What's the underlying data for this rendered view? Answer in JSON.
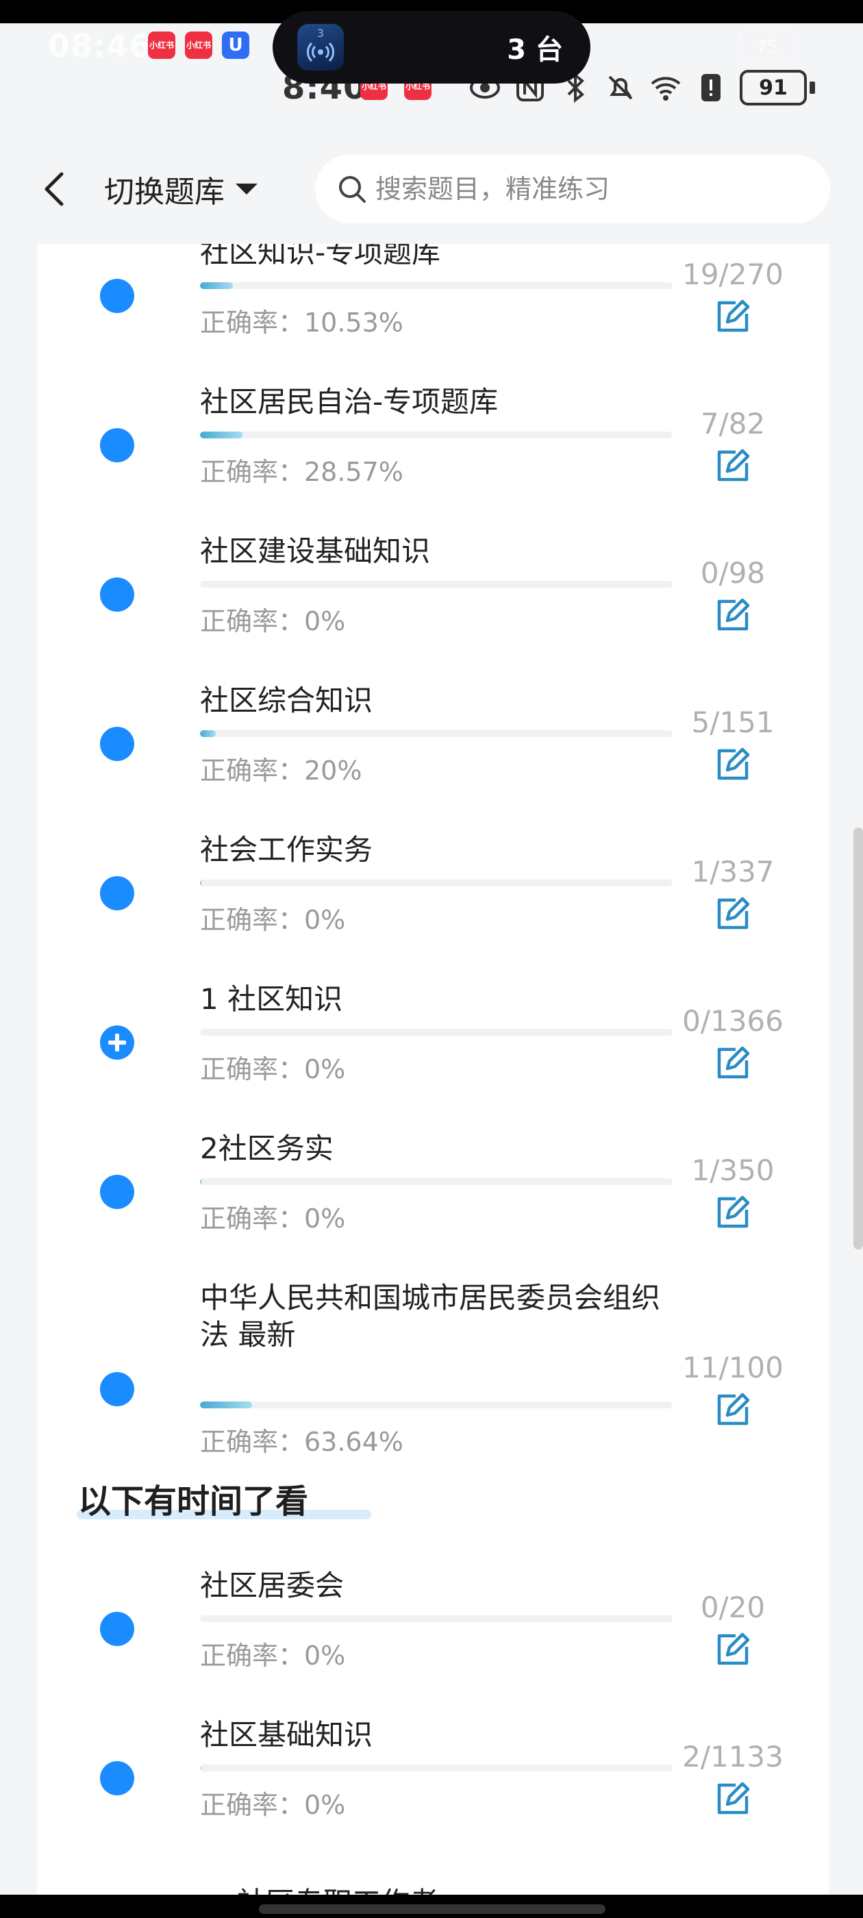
{
  "status_bar": {
    "time": "8:40",
    "time_overlay": "08:46",
    "battery": "91",
    "battery_overlay": "75",
    "app_badges": [
      {
        "label": "小红书",
        "color": "#ef2f42"
      },
      {
        "label": "小红书",
        "color": "#ef2f42"
      },
      {
        "label": "U",
        "color": "#2f6df6"
      }
    ],
    "time_badges": [
      {
        "label": "小红书",
        "color": "#ef2f42"
      },
      {
        "label": "小红书",
        "color": "#ef2f42"
      }
    ]
  },
  "island": {
    "icon_badge": "3",
    "text": "3 台"
  },
  "header": {
    "back_icon": "chevron-left-icon",
    "bank_switch_label": "切换题库",
    "search_placeholder": "搜索题目，精准练习"
  },
  "items_group1": [
    {
      "name": "社区知识-专项题库",
      "rate": "正确率：10.53%",
      "count": "19/270",
      "progress": 0.07,
      "marker": "dot"
    },
    {
      "name": "社区居民自治-专项题库",
      "rate": "正确率：28.57%",
      "count": "7/82",
      "progress": 0.09,
      "marker": "dot"
    },
    {
      "name": "社区建设基础知识",
      "rate": "正确率：0%",
      "count": "0/98",
      "progress": 0.0,
      "marker": "dot"
    },
    {
      "name": "社区综合知识",
      "rate": "正确率：20%",
      "count": "5/151",
      "progress": 0.033,
      "marker": "dot"
    },
    {
      "name": "社会工作实务",
      "rate": "正确率：0%",
      "count": "1/337",
      "progress": 0.003,
      "marker": "dot"
    },
    {
      "name": "1 社区知识",
      "rate": "正确率：0%",
      "count": "0/1366",
      "progress": 0.0,
      "marker": "plus"
    },
    {
      "name": "2社区务实",
      "rate": "正确率：0%",
      "count": "1/350",
      "progress": 0.003,
      "marker": "dot"
    },
    {
      "name": "中华人民共和国城市居民委员会组织法 最新",
      "rate": "正确率：63.64%",
      "count": "11/100",
      "progress": 0.11,
      "marker": "dot"
    }
  ],
  "section": {
    "title": "以下有时间了看"
  },
  "items_group2": [
    {
      "name": "社区居委会",
      "rate": "正确率：0%",
      "count": "0/20",
      "progress": 0.0,
      "marker": "dot"
    },
    {
      "name": "社区基础知识",
      "rate": "正确率：0%",
      "count": "2/1133",
      "progress": 0.002,
      "marker": "dot"
    }
  ],
  "peek_item": {
    "name": "社区专职工作者"
  },
  "colors": {
    "accent": "#1a8cff",
    "progress": "#46a9d6",
    "edit_icon": "#2a8cc4",
    "count_text": "#b0b0b0",
    "rate_text": "#9a9a9a"
  },
  "icons": {
    "edit": "edit-note-icon",
    "search": "search-icon"
  }
}
